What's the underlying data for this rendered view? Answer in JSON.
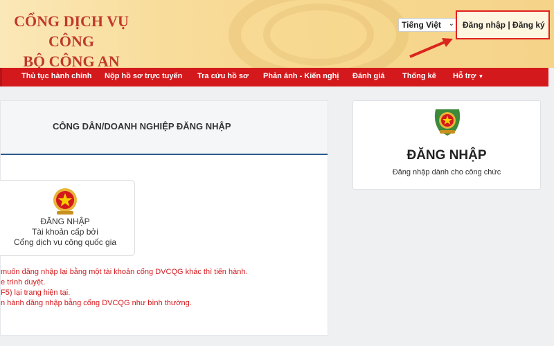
{
  "header": {
    "title_line1": "CỔNG DỊCH VỤ CÔNG",
    "title_line2": "BỘ CÔNG AN",
    "language": "Tiếng Việt",
    "login_link": "Đăng nhập",
    "separator": "|",
    "register_link": "Đăng ký"
  },
  "nav": {
    "items": [
      "Thủ tục hành chính",
      "Nộp hồ sơ trực tuyến",
      "Tra cứu hồ sơ",
      "Phản ánh - Kiến nghị",
      "Đánh giá",
      "Thống kê",
      "Hỗ trợ"
    ]
  },
  "main": {
    "title": "CÔNG DÂN/DOANH NGHIỆP ĐĂNG NHẬP",
    "card": {
      "line1": "ĐĂNG NHẬP",
      "line2": "Tài khoản cấp bởi",
      "line3": "Cổng dịch vụ công quốc gia"
    },
    "notes": [
      "muốn đăng nhập lại bằng một tài khoản cổng DVCQG khác thì tiến hành.",
      "e trình duyệt.",
      "F5) lại trang hiện tại.",
      "n hành đăng nhập bằng cổng DVCQG như bình thường."
    ]
  },
  "right": {
    "title": "ĐĂNG NHẬP",
    "subtitle": "Đăng nhập dành cho công chức"
  },
  "colors": {
    "accent_red": "#d4191c",
    "highlight_border": "#e02020",
    "header_bg": "#f7d88f"
  }
}
